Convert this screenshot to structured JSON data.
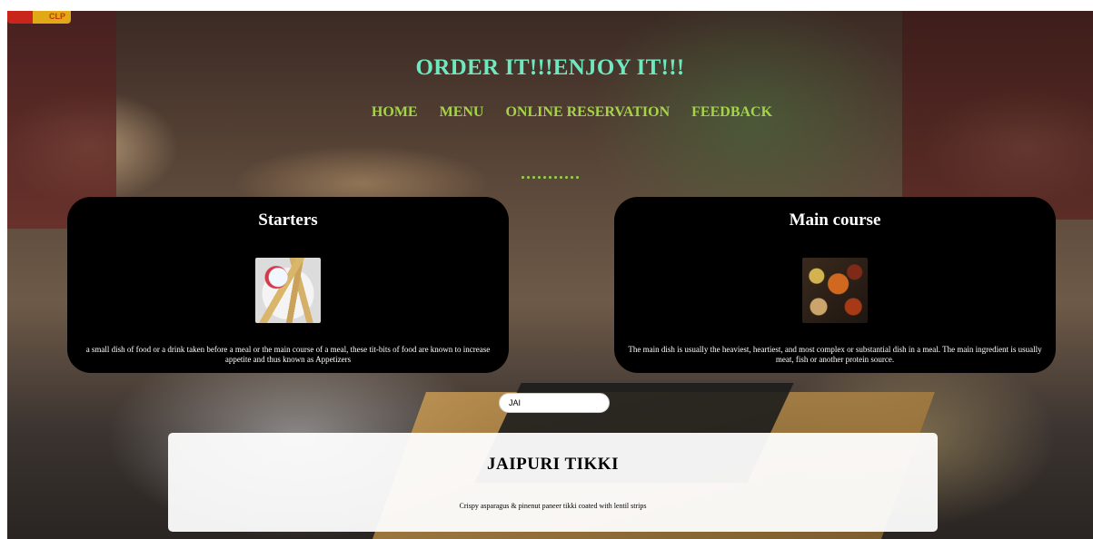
{
  "header": {
    "logo_text": "CLP",
    "title": "ORDER IT!!!ENJOY IT!!!"
  },
  "nav": {
    "items": [
      {
        "label": "HOME"
      },
      {
        "label": "MENU"
      },
      {
        "label": "ONLINE RESERVATION"
      },
      {
        "label": "FEEDBACK"
      }
    ]
  },
  "cards": {
    "starters": {
      "title": "Starters",
      "description": "a small dish of food or a drink taken before a meal or the main course of a meal, these tit-bits of food are known to increase appetite and thus known as Appetizers"
    },
    "main_course": {
      "title": "Main course",
      "description": "The main dish is usually the heaviest, heartiest, and most complex or substantial dish in a meal. The main ingredient is usually meat, fish or another protein source."
    }
  },
  "search": {
    "value": "JAI"
  },
  "result": {
    "title": "JAIPURI TIKKI",
    "description": "Crispy asparagus & pinenut paneer tikki coated with lentil strips"
  },
  "colors": {
    "title": "#6fe8c0",
    "nav": "#a5d44a",
    "card_bg": "#000000",
    "panel_bg": "#ffffff"
  }
}
